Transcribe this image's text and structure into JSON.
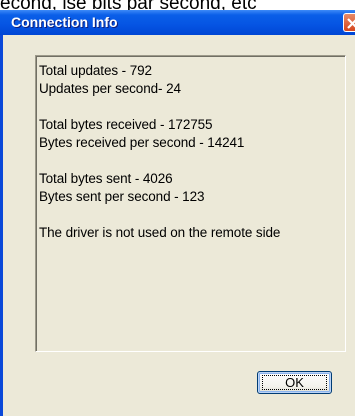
{
  "background": {
    "text": "econd, ise bits par second, etc"
  },
  "window": {
    "title": "Connection Info",
    "close_icon": "close-icon"
  },
  "info": {
    "lines": [
      "Total updates - 792",
      "Updates per second- 24",
      "",
      "Total bytes received - 172755",
      "Bytes received per second - 14241",
      "",
      "Total bytes sent - 4026",
      "Bytes sent per second - 123",
      "",
      "The driver is not used on the remote side"
    ]
  },
  "buttons": {
    "ok_label": "OK"
  },
  "colors": {
    "titlebar": "#0554e3",
    "window_face": "#ece9d8",
    "close_button": "#d6461d"
  }
}
